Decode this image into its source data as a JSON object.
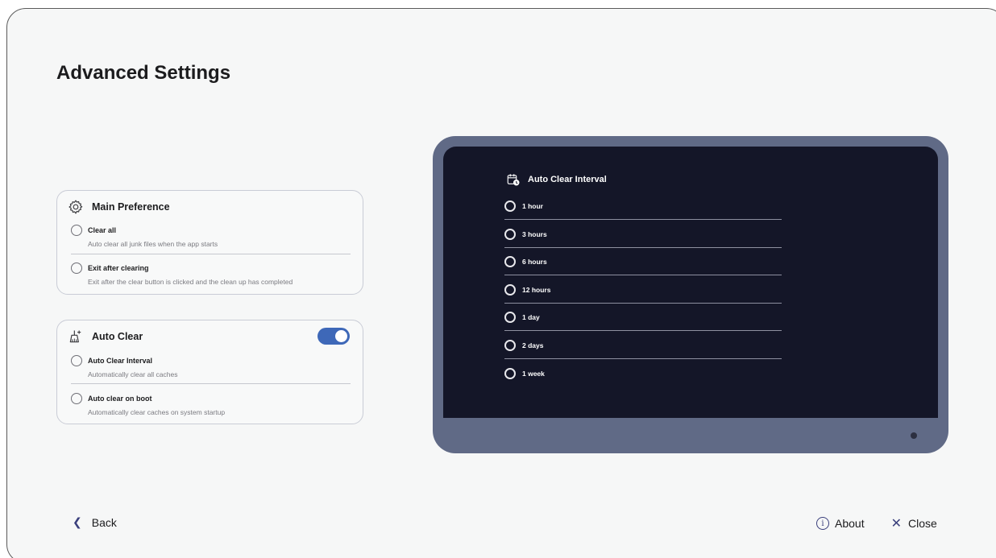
{
  "page": {
    "title": "Advanced Settings"
  },
  "main_preference": {
    "title": "Main Preference",
    "icon": "gear-icon",
    "options": [
      {
        "label": "Clear all",
        "description": "Auto clear all junk files when the app starts",
        "selected": false
      },
      {
        "label": "Exit after clearing",
        "description": "Exit after the clear button is clicked and the clean up has completed",
        "selected": false
      }
    ]
  },
  "auto_clear": {
    "title": "Auto Clear",
    "icon": "broom-icon",
    "enabled": true,
    "options": [
      {
        "label": "Auto Clear Interval",
        "description": "Automatically clear all caches",
        "selected": false
      },
      {
        "label": "Auto clear on boot",
        "description": "Automatically clear caches on system startup",
        "selected": false
      }
    ]
  },
  "preview": {
    "title": "Auto Clear Interval",
    "icon": "calendar-clock-icon",
    "intervals": [
      "1 hour",
      "3 hours",
      "6 hours",
      "12 hours",
      "1 day",
      "2 days",
      "1 week"
    ]
  },
  "footer": {
    "back": "Back",
    "about": "About",
    "close": "Close"
  },
  "colors": {
    "accent": "#3e68b8",
    "monitor_frame": "#606a86",
    "screen_bg": "#141628",
    "icon": "#3a3f7c"
  }
}
